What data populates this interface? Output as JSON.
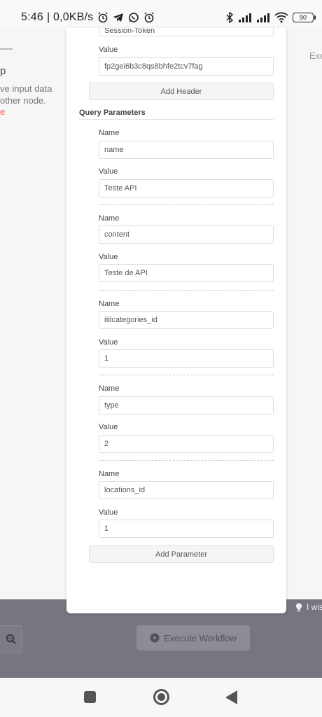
{
  "status_bar": {
    "time": "5:46",
    "speed": "| 0,0KB/s",
    "left_icons": [
      "alarm-icon",
      "telegram-icon",
      "whatsapp-icon",
      "alarm-icon"
    ],
    "battery": "90"
  },
  "background": {
    "left_title": "p",
    "left_line1": "ve input data",
    "left_line2": "other node.",
    "left_link": "e",
    "right_label": "Exe",
    "hint_text": "I wis",
    "execute_button": "Execute Workflow"
  },
  "headers": {
    "partial_value_top": "Session-Token",
    "value_label": "Value",
    "value": "fp2gei6b3c8qs8bhfe2tcv7fag",
    "add_button": "Add Header"
  },
  "query": {
    "title": "Query Parameters",
    "name_label": "Name",
    "value_label": "Value",
    "params": [
      {
        "name": "name",
        "value": "Teste API"
      },
      {
        "name": "content",
        "value": "Teste de API"
      },
      {
        "name": "itilcategories_id",
        "value": "1"
      },
      {
        "name": "type",
        "value": "2"
      },
      {
        "name": "locations_id",
        "value": "1"
      }
    ],
    "add_button": "Add Parameter"
  }
}
